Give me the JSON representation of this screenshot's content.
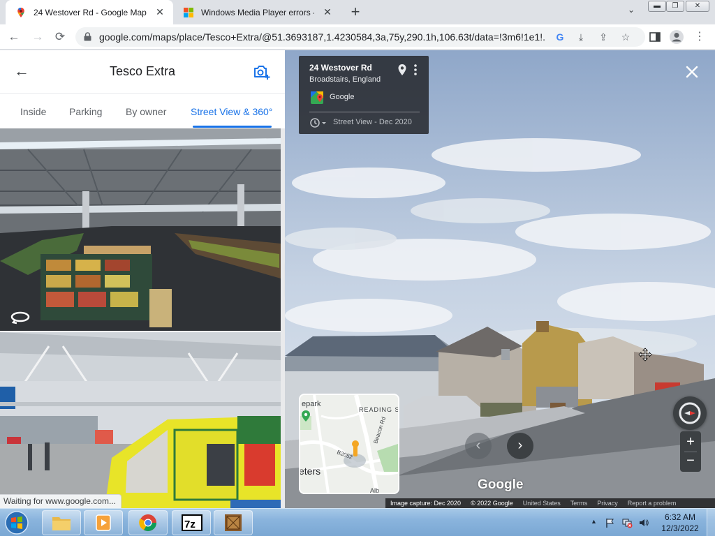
{
  "browser": {
    "tabs": [
      {
        "title": "24 Westover Rd - Google Maps",
        "active": true
      },
      {
        "title": "Windows Media Player errors - M",
        "active": false
      }
    ],
    "url": "google.com/maps/place/Tesco+Extra/@51.3693187,1.4230584,3a,75y,290.1h,106.63t/data=!3m6!1e1!...",
    "status": "Waiting for www.google.com..."
  },
  "panel": {
    "title": "Tesco Extra",
    "tabs": [
      "Inside",
      "Parking",
      "By owner",
      "Street View & 360°"
    ],
    "active_tab": "Street View & 360°"
  },
  "streetview": {
    "address": "24 Westover Rd",
    "locality": "Broadstairs, England",
    "provider": "Google",
    "date_label": "Street View - Dec 2020",
    "watermark": "Google",
    "minimap": {
      "labels": [
        "epark",
        "READING S",
        "Beacon Rd",
        "B2052",
        "eters",
        "Alb"
      ]
    },
    "attribution": {
      "capture": "Image capture: Dec 2020",
      "copyright": "© 2022 Google",
      "links": [
        "United States",
        "Terms",
        "Privacy",
        "Report a problem"
      ]
    }
  },
  "taskbar": {
    "time": "6:32 AM",
    "date": "12/3/2022",
    "apps": [
      "windows-explorer",
      "media-player",
      "chrome",
      "7-zip",
      "dosbox"
    ]
  },
  "colors": {
    "accent": "#1a73e8",
    "tab_strip": "#dee1e6",
    "info_card": "#202124"
  }
}
